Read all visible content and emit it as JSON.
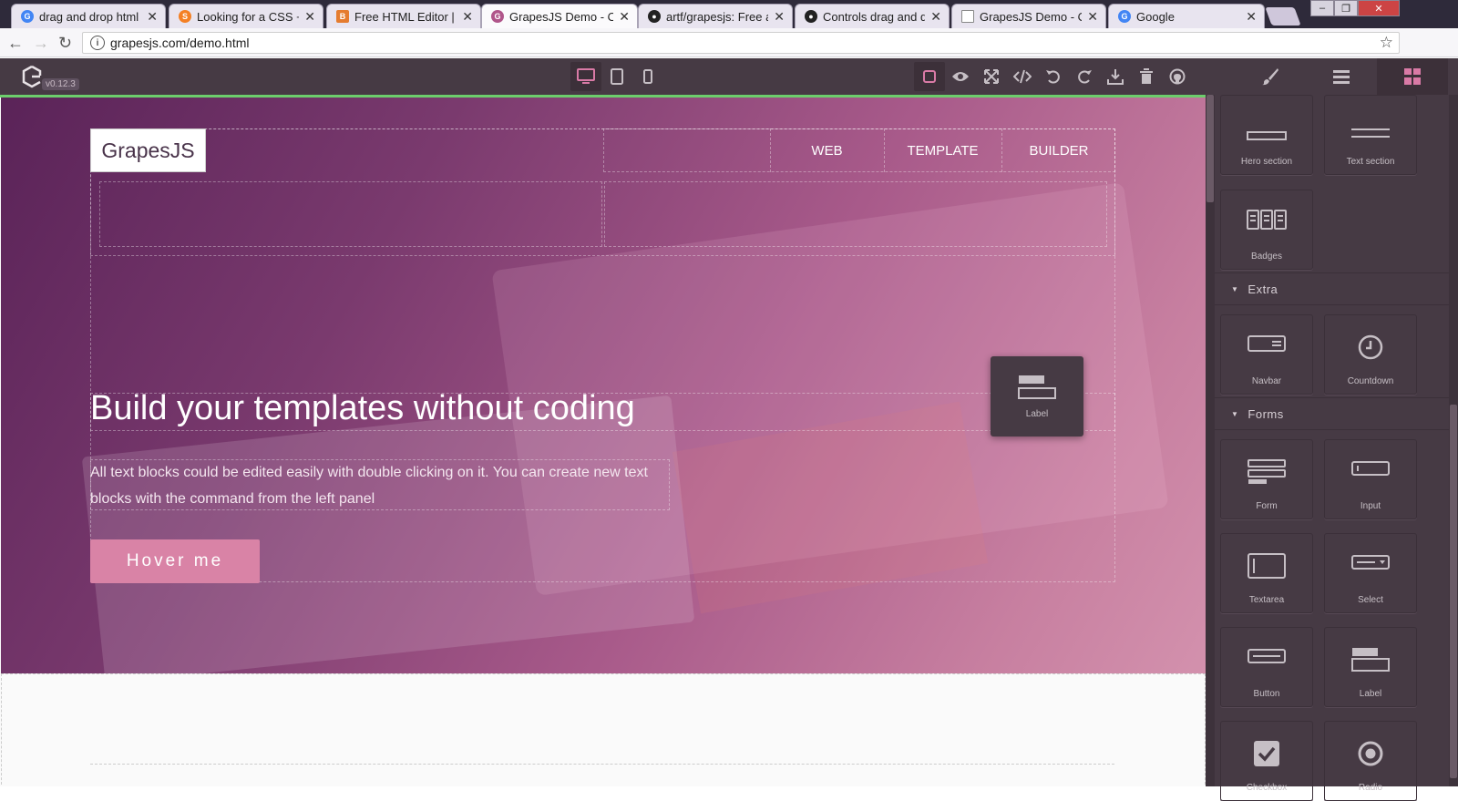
{
  "browser": {
    "tabs": [
      {
        "title": "drag and drop html e",
        "favicon": "google-icon",
        "active": false
      },
      {
        "title": "Looking for a CSS + H",
        "favicon": "stackoverflow-icon",
        "active": false
      },
      {
        "title": "Free HTML Editor | Co",
        "favicon": "html-editor-icon",
        "active": false
      },
      {
        "title": "GrapesJS Demo - Op",
        "favicon": "grapesjs-icon",
        "active": true
      },
      {
        "title": "artf/grapesjs: Free an",
        "favicon": "github-icon",
        "active": false
      },
      {
        "title": "Controls drag and dr",
        "favicon": "github-icon",
        "active": false
      },
      {
        "title": "GrapesJS Demo - Op",
        "favicon": "page-icon",
        "active": false
      },
      {
        "title": "Google",
        "favicon": "google-icon",
        "active": false
      }
    ],
    "url": "grapesjs.com/demo.html"
  },
  "editor": {
    "version": "v0.12.3",
    "device_buttons": [
      "desktop",
      "tablet",
      "mobile"
    ],
    "option_buttons": [
      "sw-visibility",
      "preview",
      "fullscreen",
      "export-code",
      "undo",
      "redo",
      "import",
      "clear-canvas",
      "github"
    ],
    "panel_tabs": [
      "style-manager",
      "layer-manager",
      "blocks"
    ]
  },
  "canvas": {
    "brand": "GrapesJS",
    "menu": [
      "WEB",
      "TEMPLATE",
      "BUILDER"
    ],
    "hero_title": "Build your templates without coding",
    "hero_lead": "All text blocks could be edited easily with double clicking on it. You can create new text blocks with the command from the left panel",
    "hero_button": "Hover me",
    "drag_ghost_label": "Label"
  },
  "blocks_panel": {
    "top_blocks": [
      {
        "label": "Hero section"
      },
      {
        "label": "Text section"
      },
      {
        "label": "Badges"
      }
    ],
    "categories": [
      {
        "name": "Extra",
        "blocks": [
          "Navbar",
          "Countdown"
        ]
      },
      {
        "name": "Forms",
        "blocks": [
          "Form",
          "Input",
          "Textarea",
          "Select",
          "Button",
          "Label",
          "Checkbox",
          "Radio"
        ]
      }
    ]
  },
  "colors": {
    "editor_bg": "#463a44",
    "accent": "#d97aa6",
    "icon": "#c6bfc5",
    "hero_button": "#d983a6"
  }
}
